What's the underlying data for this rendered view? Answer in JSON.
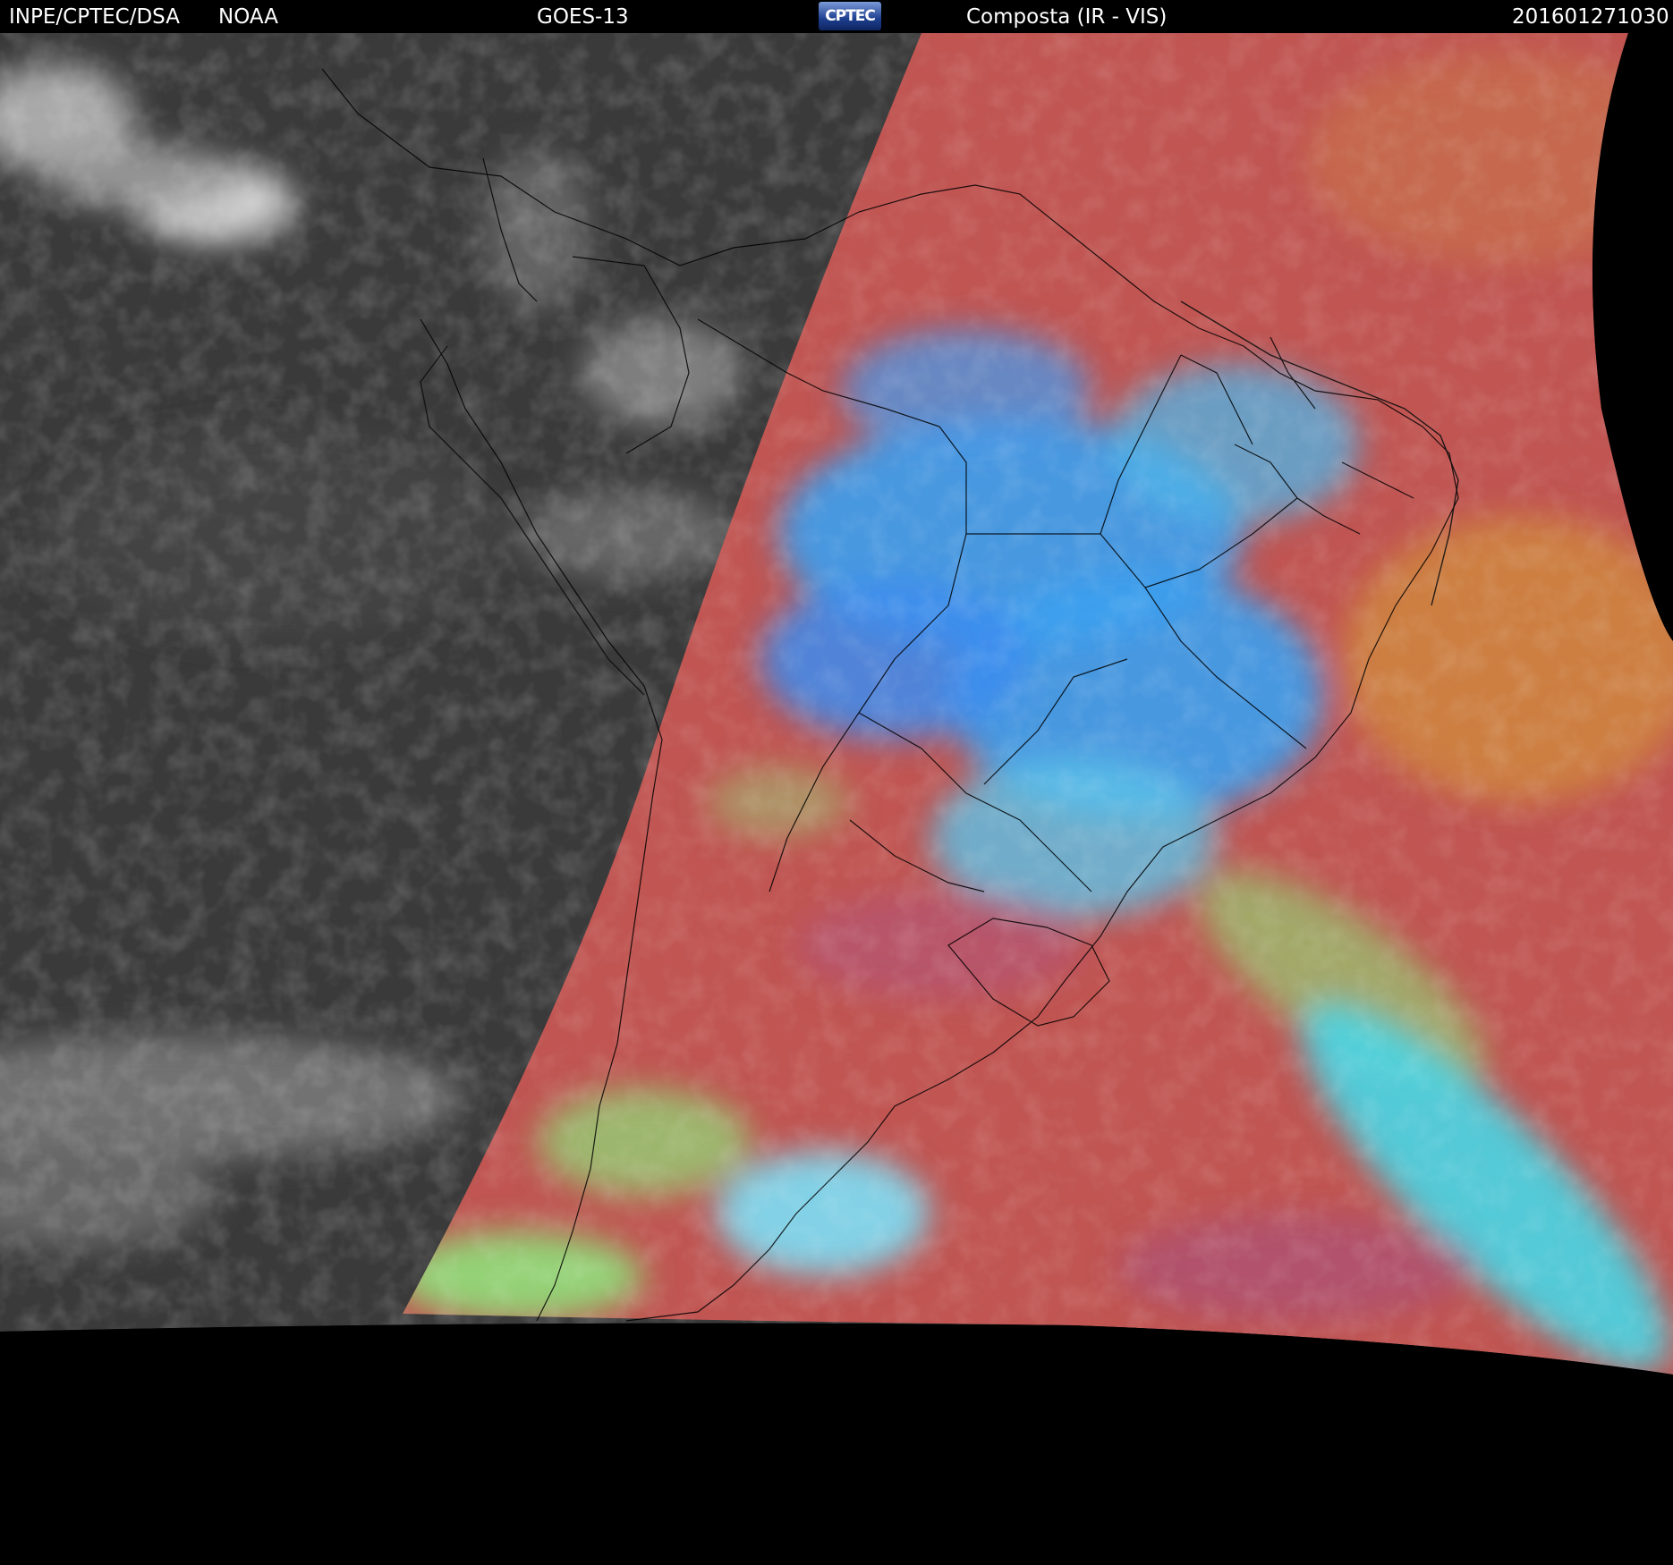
{
  "header": {
    "source": "INPE/CPTEC/DSA",
    "agency": "NOAA",
    "satellite": "GOES-13",
    "logo_text": "CPTEC",
    "product": "Composta (IR - VIS)",
    "timestamp": "201601271030"
  },
  "map": {
    "night_color": "#3a3a3a",
    "day_base_color": "#c05552",
    "cloud_blue_color": "#3aa0f0",
    "cloud_cyan_color": "#48d6e6",
    "cloud_green_color": "#8fe07a",
    "border_color": "#000000",
    "space_color": "#000000"
  }
}
